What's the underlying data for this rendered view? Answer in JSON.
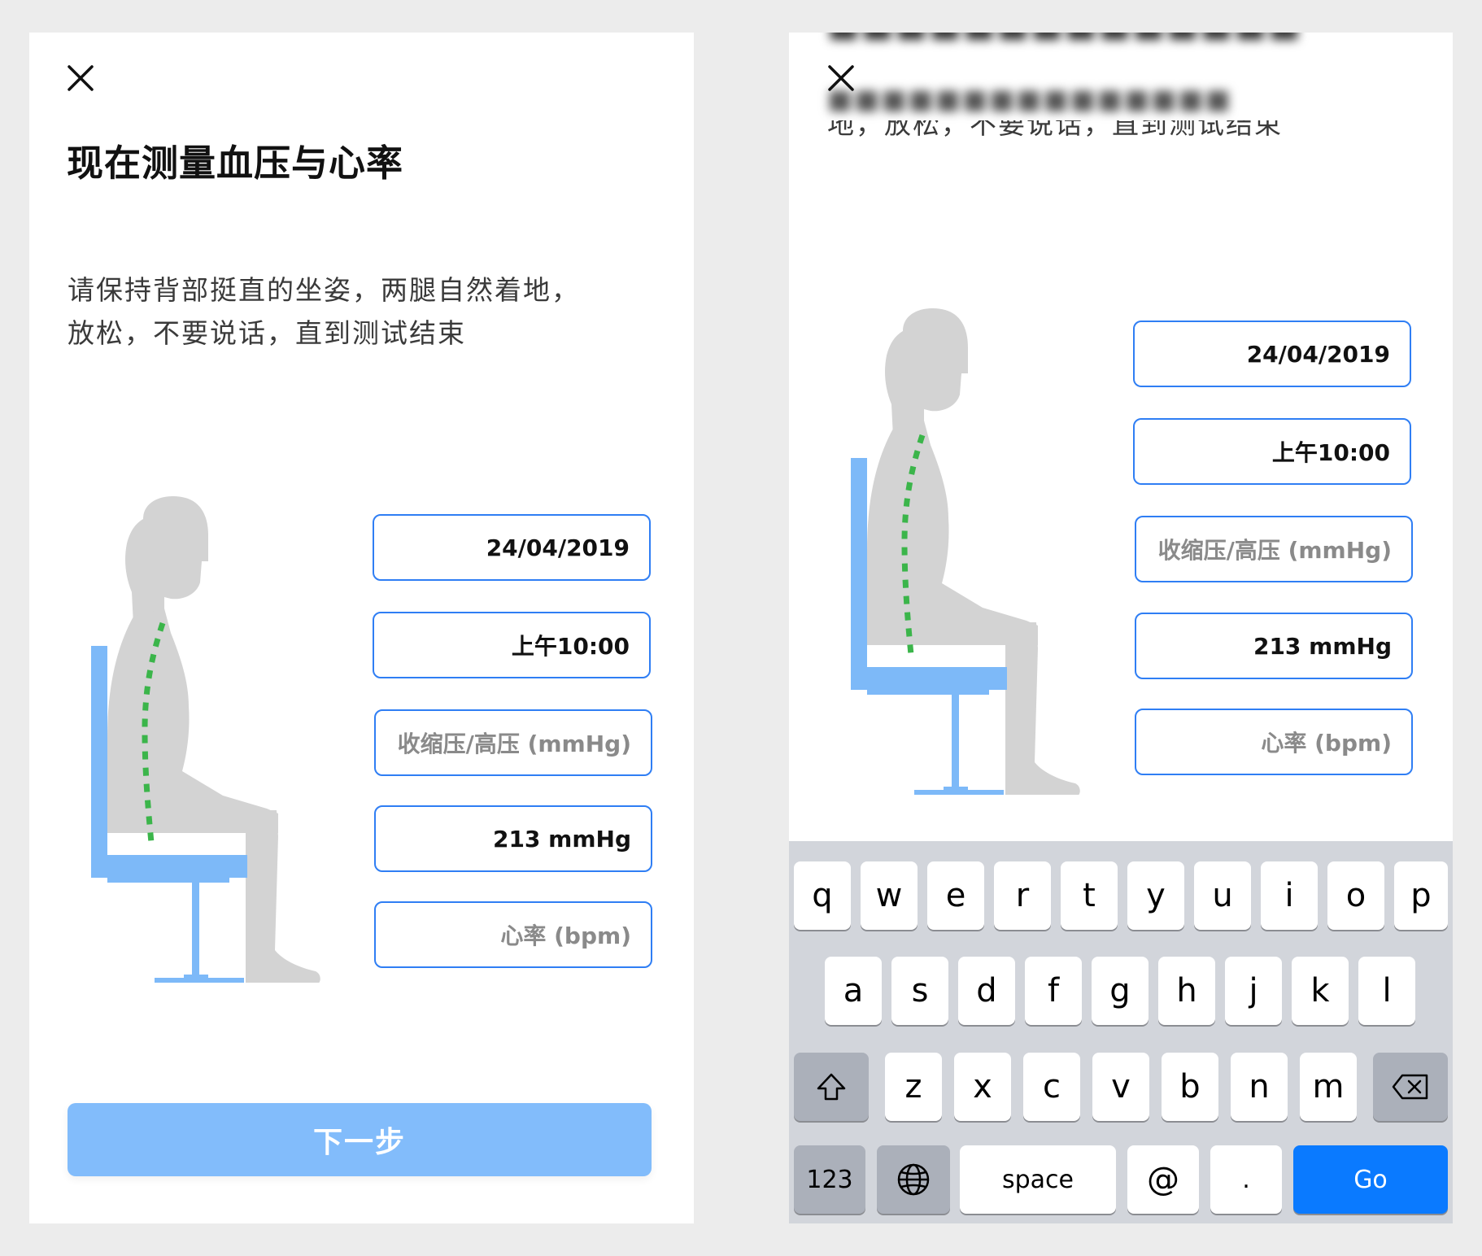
{
  "left_screen": {
    "close_label": "✕",
    "title": "现在测量血压与心率",
    "instruction": "请保持背部挺直的坐姿，两腿自然着地，放松，不要说话，直到测试结束",
    "fields": {
      "date": "24/04/2019",
      "time": "上午10:00",
      "systolic_placeholder": "收缩压/高压 (mmHg)",
      "diastolic": "213 mmHg",
      "heart_rate_placeholder": "心率 (bpm)"
    },
    "next_button": "下一步"
  },
  "right_screen": {
    "close_label": "✕",
    "instruction_line2": "地，放松，不要说话，直到测试结束",
    "fields": {
      "date": "24/04/2019",
      "time": "上午10:00",
      "systolic_placeholder": "收缩压/高压 (mmHg)",
      "diastolic": "213 mmHg",
      "heart_rate_placeholder": "心率 (bpm)"
    },
    "keyboard": {
      "row1": [
        "q",
        "w",
        "e",
        "r",
        "t",
        "y",
        "u",
        "i",
        "o",
        "p"
      ],
      "row2": [
        "a",
        "s",
        "d",
        "f",
        "g",
        "h",
        "j",
        "k",
        "l"
      ],
      "row3": [
        "z",
        "x",
        "c",
        "v",
        "b",
        "n",
        "m"
      ],
      "numbers_key": "123",
      "space_key": "space",
      "at_key": "@",
      "dot_key": ".",
      "go_key": "Go"
    }
  },
  "colors": {
    "accent_blue": "#2f7ef4",
    "button_blue": "#82bcfb",
    "chair_blue": "#7db9f8",
    "spine_green": "#3bb54a",
    "figure_gray": "#d3d3d3",
    "keyboard_bg": "#d2d5db",
    "go_blue": "#0a7aff"
  }
}
